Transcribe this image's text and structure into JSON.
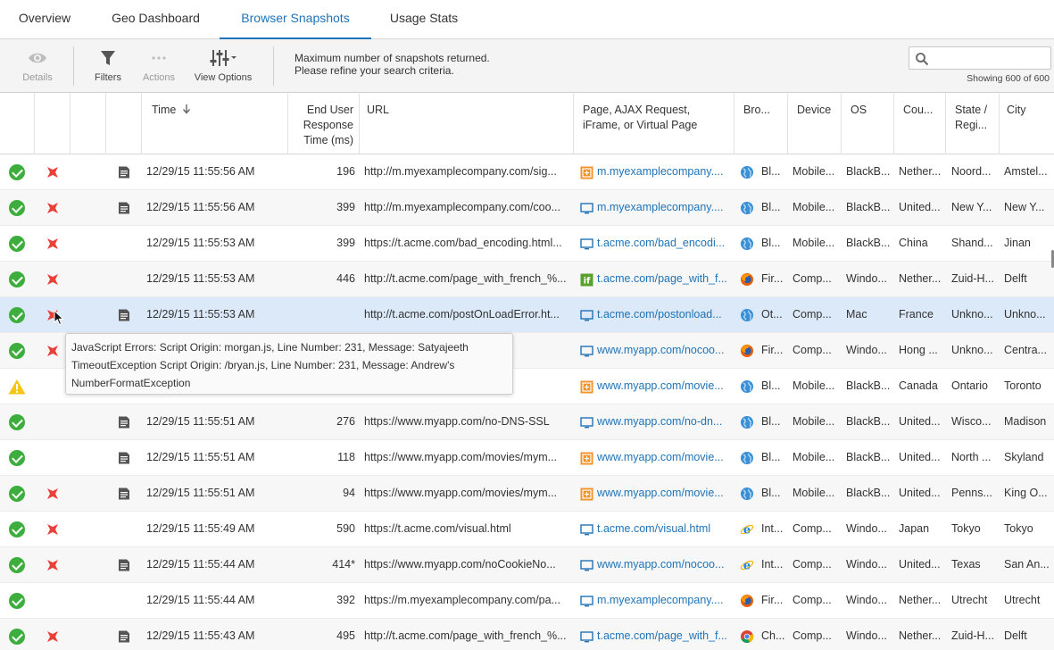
{
  "tabs": [
    {
      "label": "Overview",
      "active": false
    },
    {
      "label": "Geo Dashboard",
      "active": false
    },
    {
      "label": "Browser Snapshots",
      "active": true
    },
    {
      "label": "Usage Stats",
      "active": false
    }
  ],
  "toolbar": {
    "details_label": "Details",
    "filters_label": "Filters",
    "actions_label": "Actions",
    "view_options_label": "View Options",
    "message_line1": "Maximum number of snapshots returned.",
    "message_line2": "Please refine your search criteria.",
    "search_placeholder": "",
    "showing": "Showing 600 of 600"
  },
  "columns": {
    "time": "Time",
    "response": "End User Response Time (ms)",
    "url": "URL",
    "page": "Page, AJAX Request, iFrame, or Virtual Page",
    "browser": "Bro...",
    "device": "Device",
    "os": "OS",
    "country": "Cou...",
    "state": "State / Regi...",
    "city": "City"
  },
  "colors": {
    "accent": "#1f73b7",
    "ok": "#3dae3d",
    "error": "#e8413c",
    "warning": "#f5c518",
    "selected_row": "#dbe9f8"
  },
  "rows": [
    {
      "status": "ok",
      "error": true,
      "snapshot": true,
      "time": "12/29/15 11:55:56 AM",
      "response": "196",
      "url": "http://m.myexamplecompany.com/sig...",
      "ptype": "ajax",
      "page": "m.myexamplecompany....",
      "browser_icon": "blackberry",
      "browser": "Bl...",
      "device": "Mobile...",
      "os": "BlackB...",
      "country": "Nether...",
      "state": "Noord...",
      "city": "Amstel..."
    },
    {
      "status": "ok",
      "error": true,
      "snapshot": true,
      "time": "12/29/15 11:55:56 AM",
      "response": "399",
      "url": "http://m.myexamplecompany.com/coo...",
      "ptype": "page",
      "page": "m.myexamplecompany....",
      "browser_icon": "blackberry",
      "browser": "Bl...",
      "device": "Mobile...",
      "os": "BlackB...",
      "country": "United...",
      "state": "New Y...",
      "city": "New Y..."
    },
    {
      "status": "ok",
      "error": true,
      "snapshot": false,
      "time": "12/29/15 11:55:53 AM",
      "response": "399",
      "url": "https://t.acme.com/bad_encoding.html...",
      "ptype": "page",
      "page": "t.acme.com/bad_encodi...",
      "browser_icon": "blackberry",
      "browser": "Bl...",
      "device": "Mobile...",
      "os": "BlackB...",
      "country": "China",
      "state": "Shand...",
      "city": "Jinan"
    },
    {
      "status": "ok",
      "error": true,
      "snapshot": false,
      "time": "12/29/15 11:55:53 AM",
      "response": "446",
      "url": "http://t.acme.com/page_with_french_%...",
      "ptype": "iframe",
      "page": "t.acme.com/page_with_f...",
      "browser_icon": "firefox",
      "browser": "Fir...",
      "device": "Comp...",
      "os": "Windo...",
      "country": "Nether...",
      "state": "Zuid-H...",
      "city": "Delft"
    },
    {
      "status": "ok",
      "error": true,
      "snapshot": true,
      "selected": true,
      "time": "12/29/15 11:55:53 AM",
      "response": "",
      "url": "http://t.acme.com/postOnLoadError.ht...",
      "ptype": "page",
      "page": "t.acme.com/postonload...",
      "browser_icon": "other",
      "browser": "Ot...",
      "device": "Comp...",
      "os": "Mac",
      "country": "France",
      "state": "Unkno...",
      "city": "Unkno..."
    },
    {
      "status": "ok",
      "error": true,
      "snapshot": false,
      "time": "",
      "response": "",
      "url": "ookieNo...",
      "ptype": "page",
      "page": "www.myapp.com/nocoo...",
      "browser_icon": "firefox",
      "browser": "Fir...",
      "device": "Comp...",
      "os": "Windo...",
      "country": "Hong ...",
      "state": "Unkno...",
      "city": "Centra..."
    },
    {
      "status": "warn",
      "error": false,
      "snapshot": false,
      "time": "",
      "response": "",
      "url": "/ies/mym...",
      "ptype": "ajax",
      "page": "www.myapp.com/movie...",
      "browser_icon": "blackberry",
      "browser": "Bl...",
      "device": "Mobile...",
      "os": "BlackB...",
      "country": "Canada",
      "state": "Ontario",
      "city": "Toronto"
    },
    {
      "status": "ok",
      "error": false,
      "snapshot": true,
      "time": "12/29/15 11:55:51 AM",
      "response": "276",
      "url": "https://www.myapp.com/no-DNS-SSL",
      "ptype": "page",
      "page": "www.myapp.com/no-dn...",
      "browser_icon": "blackberry",
      "browser": "Bl...",
      "device": "Mobile...",
      "os": "BlackB...",
      "country": "United...",
      "state": "Wisco...",
      "city": "Madison"
    },
    {
      "status": "ok",
      "error": false,
      "snapshot": true,
      "time": "12/29/15 11:55:51 AM",
      "response": "118",
      "url": "https://www.myapp.com/movies/mym...",
      "ptype": "ajax",
      "page": "www.myapp.com/movie...",
      "browser_icon": "blackberry",
      "browser": "Bl...",
      "device": "Mobile...",
      "os": "BlackB...",
      "country": "United...",
      "state": "North ...",
      "city": "Skyland"
    },
    {
      "status": "ok",
      "error": true,
      "snapshot": true,
      "time": "12/29/15 11:55:51 AM",
      "response": "94",
      "url": "https://www.myapp.com/movies/mym...",
      "ptype": "ajax",
      "page": "www.myapp.com/movie...",
      "browser_icon": "blackberry",
      "browser": "Bl...",
      "device": "Mobile...",
      "os": "BlackB...",
      "country": "United...",
      "state": "Penns...",
      "city": "King O..."
    },
    {
      "status": "ok",
      "error": true,
      "snapshot": false,
      "time": "12/29/15 11:55:49 AM",
      "response": "590",
      "url": "https://t.acme.com/visual.html",
      "ptype": "page",
      "page": "t.acme.com/visual.html",
      "browser_icon": "ie",
      "browser": "Int...",
      "device": "Comp...",
      "os": "Windo...",
      "country": "Japan",
      "state": "Tokyo",
      "city": "Tokyo"
    },
    {
      "status": "ok",
      "error": true,
      "snapshot": true,
      "time": "12/29/15 11:55:44 AM",
      "response": "414*",
      "url": "https://www.myapp.com/noCookieNo...",
      "ptype": "page",
      "page": "www.myapp.com/nocoo...",
      "browser_icon": "ie",
      "browser": "Int...",
      "device": "Comp...",
      "os": "Windo...",
      "country": "United...",
      "state": "Texas",
      "city": "San An..."
    },
    {
      "status": "ok",
      "error": false,
      "snapshot": false,
      "time": "12/29/15 11:55:44 AM",
      "response": "392",
      "url": "https://m.myexamplecompany.com/pa...",
      "ptype": "page",
      "page": "m.myexamplecompany....",
      "browser_icon": "firefox",
      "browser": "Fir...",
      "device": "Comp...",
      "os": "Windo...",
      "country": "Nether...",
      "state": "Utrecht",
      "city": "Utrecht"
    },
    {
      "status": "ok",
      "error": true,
      "snapshot": true,
      "time": "12/29/15 11:55:43 AM",
      "response": "495",
      "url": "http://t.acme.com/page_with_french_%...",
      "ptype": "page",
      "page": "t.acme.com/page_with_f...",
      "browser_icon": "chrome",
      "browser": "Ch...",
      "device": "Comp...",
      "os": "Windo...",
      "country": "Nether...",
      "state": "Zuid-H...",
      "city": "Delft"
    }
  ],
  "tooltip": {
    "line1": "JavaScript Errors: Script Origin: morgan.js, Line Number: 231, Message: Satyajeeth",
    "line2": "TimeoutException Script Origin: /bryan.js, Line Number: 231, Message: Andrew's",
    "line3": "NumberFormatException"
  }
}
